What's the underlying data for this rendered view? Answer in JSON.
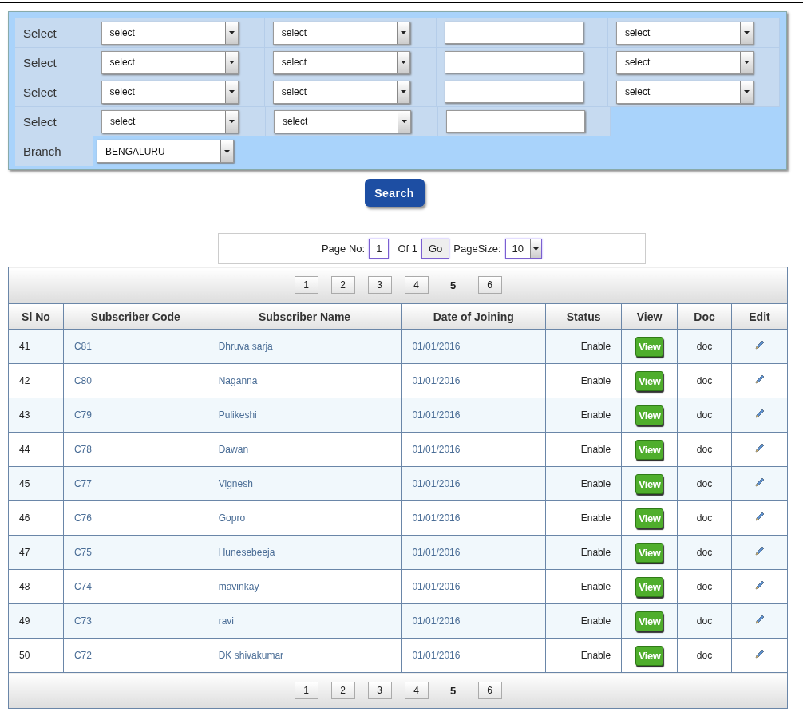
{
  "filters": [
    {
      "label": "Select",
      "fields": [
        {
          "kind": "select",
          "value": "select"
        },
        {
          "kind": "select",
          "value": "select"
        },
        {
          "kind": "text"
        },
        {
          "kind": "select",
          "value": "select"
        }
      ]
    },
    {
      "label": "Select",
      "fields": [
        {
          "kind": "select",
          "value": "select"
        },
        {
          "kind": "select",
          "value": "select"
        },
        {
          "kind": "text"
        },
        {
          "kind": "select",
          "value": "select"
        }
      ]
    },
    {
      "label": "Select",
      "fields": [
        {
          "kind": "select",
          "value": "select"
        },
        {
          "kind": "select",
          "value": "select"
        },
        {
          "kind": "text"
        },
        {
          "kind": "select",
          "value": "select"
        }
      ]
    },
    {
      "label": "Select",
      "fields": [
        {
          "kind": "select",
          "value": "select"
        },
        {
          "kind": "select",
          "value": "select"
        },
        {
          "kind": "text"
        }
      ]
    }
  ],
  "branch": {
    "label": "Branch",
    "value": "BENGALURU"
  },
  "search_button": "Search",
  "pager": {
    "page_label": "Page No:",
    "page_value": "1",
    "of_label": "Of 1",
    "go_button": "Go",
    "size_label": "PageSize:",
    "size_value": "10"
  },
  "pages_top": [
    {
      "label": "1",
      "selected": false
    },
    {
      "label": "2",
      "selected": false
    },
    {
      "label": "3",
      "selected": false
    },
    {
      "label": "4",
      "selected": false
    },
    {
      "label": "5",
      "selected": true
    },
    {
      "label": "6",
      "selected": false
    }
  ],
  "table": {
    "columns": [
      "Sl No",
      "Subscriber Code",
      "Subscriber Name",
      "Date of Joining",
      "Status",
      "View",
      "Doc",
      "Edit"
    ],
    "rows": [
      {
        "sl": "41",
        "code": "C81",
        "name": "Dhruva sarja",
        "date": "01/01/2016",
        "status": "Enable",
        "view": "View",
        "doc": "doc"
      },
      {
        "sl": "42",
        "code": "C80",
        "name": "Naganna",
        "date": "01/01/2016",
        "status": "Enable",
        "view": "View",
        "doc": "doc"
      },
      {
        "sl": "43",
        "code": "C79",
        "name": "Pulikeshi",
        "date": "01/01/2016",
        "status": "Enable",
        "view": "View",
        "doc": "doc"
      },
      {
        "sl": "44",
        "code": "C78",
        "name": "Dawan",
        "date": "01/01/2016",
        "status": "Enable",
        "view": "View",
        "doc": "doc"
      },
      {
        "sl": "45",
        "code": "C77",
        "name": "Vignesh",
        "date": "01/01/2016",
        "status": "Enable",
        "view": "View",
        "doc": "doc"
      },
      {
        "sl": "46",
        "code": "C76",
        "name": "Gopro",
        "date": "01/01/2016",
        "status": "Enable",
        "view": "View",
        "doc": "doc"
      },
      {
        "sl": "47",
        "code": "C75",
        "name": "Hunesebeeja",
        "date": "01/01/2016",
        "status": "Enable",
        "view": "View",
        "doc": "doc"
      },
      {
        "sl": "48",
        "code": "C74",
        "name": "mavinkay",
        "date": "01/01/2016",
        "status": "Enable",
        "view": "View",
        "doc": "doc"
      },
      {
        "sl": "49",
        "code": "C73",
        "name": "ravi",
        "date": "01/01/2016",
        "status": "Enable",
        "view": "View",
        "doc": "doc"
      },
      {
        "sl": "50",
        "code": "C72",
        "name": "DK shivakumar",
        "date": "01/01/2016",
        "status": "Enable",
        "view": "View",
        "doc": "doc"
      }
    ]
  },
  "pages_bottom": [
    {
      "label": "1",
      "selected": false
    },
    {
      "label": "2",
      "selected": false
    },
    {
      "label": "3",
      "selected": false
    },
    {
      "label": "4",
      "selected": false
    },
    {
      "label": "5",
      "selected": true
    },
    {
      "label": "6",
      "selected": false
    }
  ]
}
